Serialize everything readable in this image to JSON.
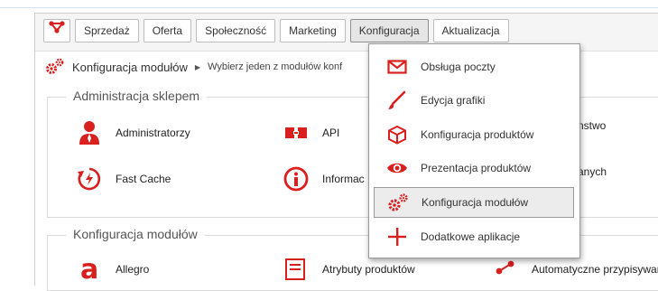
{
  "colors": {
    "accent": "#d8201e",
    "border": "#bdbdbd"
  },
  "nav": {
    "logo_icon": "share-nodes-icon",
    "items": [
      {
        "label": "Sprzedaż"
      },
      {
        "label": "Oferta"
      },
      {
        "label": "Społeczność"
      },
      {
        "label": "Marketing"
      },
      {
        "label": "Konfiguracja",
        "active": true
      },
      {
        "label": "Aktualizacja"
      }
    ]
  },
  "breadcrumb": {
    "icon": "gears-icon",
    "title": "Konfiguracja modułów",
    "separator": "▶",
    "description": "Wybierz jeden z modułów konf"
  },
  "groups": [
    {
      "legend": "Administracja sklepem",
      "tiles": [
        {
          "label": "Administratorzy",
          "icon": "user-icon"
        },
        {
          "label": "API",
          "icon": "api-icon"
        },
        {
          "label": "nstwo",
          "icon": ""
        },
        {
          "label": "Fast Cache",
          "icon": "fast-cache-icon"
        },
        {
          "label": "Informac",
          "icon": "info-icon"
        },
        {
          "label": "anych",
          "icon": ""
        }
      ]
    },
    {
      "legend": "Konfiguracja modułów",
      "tiles": [
        {
          "label": "Allegro",
          "icon": "allegro-icon"
        },
        {
          "label": "Atrybuty produktów",
          "icon": "attributes-icon"
        },
        {
          "label": "Automatyczne przypisywar",
          "icon": "share-icon"
        }
      ]
    }
  ],
  "dropdown": {
    "items": [
      {
        "label": "Obsługa poczty",
        "icon": "envelope-icon"
      },
      {
        "label": "Edycja grafiki",
        "icon": "brush-icon"
      },
      {
        "label": "Konfiguracja produktów",
        "icon": "box-icon"
      },
      {
        "label": "Prezentacja produktów",
        "icon": "eye-icon"
      },
      {
        "label": "Konfiguracja modułów",
        "icon": "gears-icon",
        "highlight": true
      },
      {
        "label": "Dodatkowe aplikacje",
        "icon": "plus-icon"
      }
    ]
  }
}
